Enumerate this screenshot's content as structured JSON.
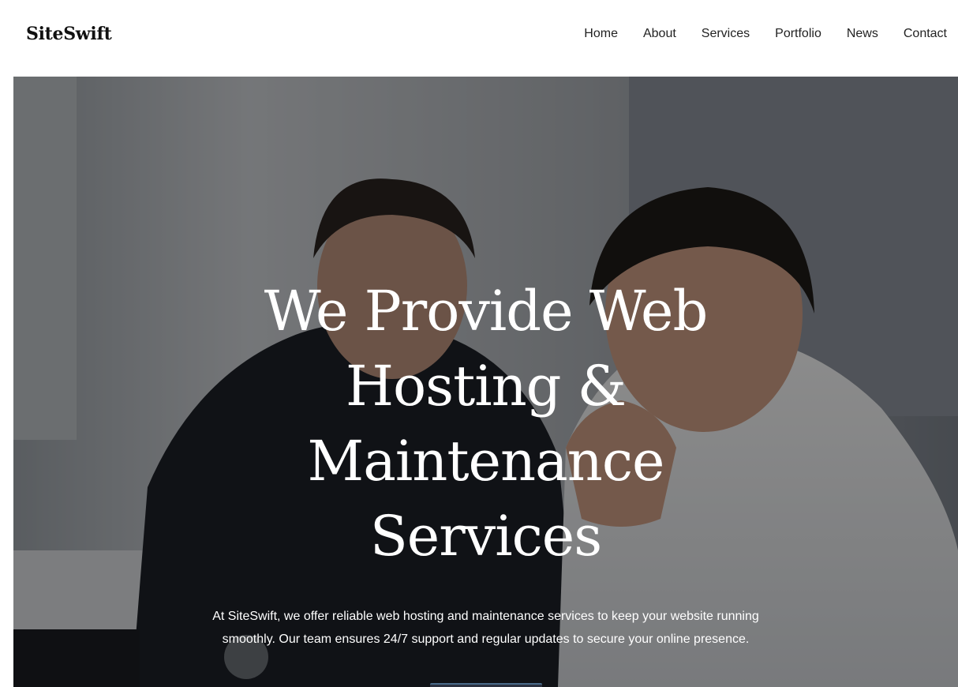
{
  "header": {
    "logo": "SiteSwift",
    "nav": [
      {
        "label": "Home"
      },
      {
        "label": "About"
      },
      {
        "label": "Services"
      },
      {
        "label": "Portfolio"
      },
      {
        "label": "News"
      },
      {
        "label": "Contact"
      }
    ]
  },
  "hero": {
    "title_lines": [
      "We Provide Web",
      "Hosting &",
      "Maintenance",
      "Services"
    ],
    "description": "At SiteSwift, we offer reliable web hosting and maintenance services to keep your website running smoothly. Our team ensures 24/7 support and regular updates to secure your online presence."
  },
  "colors": {
    "hero_text": "#ffffff",
    "nav_text": "#222222",
    "overlay": "#000000"
  }
}
